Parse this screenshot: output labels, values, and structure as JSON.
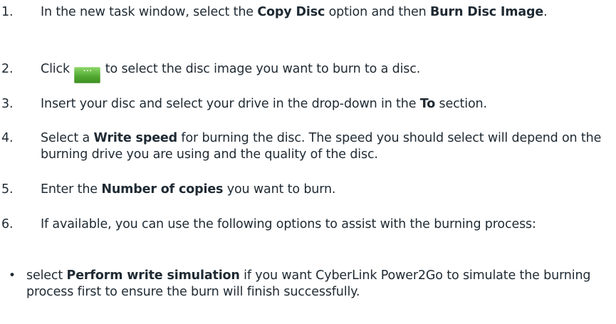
{
  "steps": [
    {
      "number": "1.",
      "parts": [
        "In the new task window, select the ",
        "Copy Disc",
        " option and then ",
        "Burn Disc Image",
        "."
      ]
    },
    {
      "number": "2.",
      "before": "Click ",
      "button_icon": "ellipsis-browse-icon",
      "button_glyph": "···",
      "after": " to select the disc image you want to burn to a disc."
    },
    {
      "number": "3.",
      "parts": [
        "Insert your disc and select your drive in the drop-down in the ",
        "To",
        " section."
      ]
    },
    {
      "number": "4.",
      "parts": [
        "Select a ",
        "Write speed",
        " for burning the disc. The speed you should select will depend on the burning drive you are using and the quality of the disc."
      ]
    },
    {
      "number": "5.",
      "parts": [
        "Enter the ",
        "Number of copies",
        " you want to burn."
      ]
    },
    {
      "number": "6.",
      "text": "If available, you can use the following options to assist with the burning process:"
    }
  ],
  "bullets": [
    {
      "symbol": "•",
      "parts": [
        "select ",
        "Perform write simulation",
        " if you want CyberLink Power2Go to simulate the burning process first to ensure the burn will finish successfully."
      ]
    }
  ],
  "colors": {
    "text": "#1f2a33",
    "button_green": "#4fa62f"
  }
}
